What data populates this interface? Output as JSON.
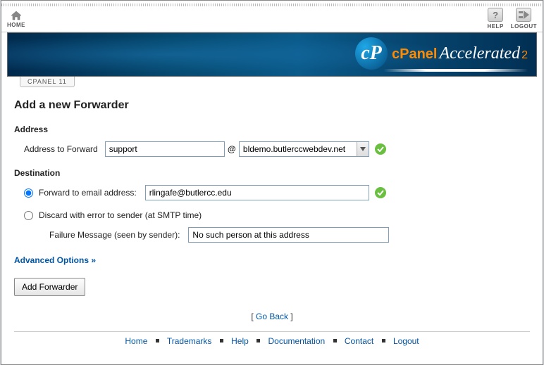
{
  "topbar": {
    "home_label": "HOME",
    "help_label": "HELP",
    "logout_label": "LOGOUT"
  },
  "tab": {
    "label": "CPANEL 11"
  },
  "brand": {
    "panel": "cPanel",
    "accel": "Accelerated",
    "sub": "2"
  },
  "page": {
    "title": "Add a new Forwarder",
    "address_section": "Address",
    "address_to_forward_label": "Address to Forward",
    "address_value": "support",
    "at": "@",
    "domain_selected": "bldemo.butlerccwebdev.net",
    "dest_section": "Destination",
    "opt_forward_label": "Forward to email address:",
    "forward_value": "rlingafe@butlercc.edu",
    "opt_discard_label": "Discard with error to sender (at SMTP time)",
    "failure_label": "Failure Message (seen by sender):",
    "failure_value": "No such person at this address",
    "advanced": "Advanced Options »",
    "submit": "Add Forwarder",
    "goback_left": "[ ",
    "goback": "Go Back",
    "goback_right": " ]"
  },
  "footer": {
    "items": [
      "Home",
      "Trademarks",
      "Help",
      "Documentation",
      "Contact",
      "Logout"
    ]
  }
}
